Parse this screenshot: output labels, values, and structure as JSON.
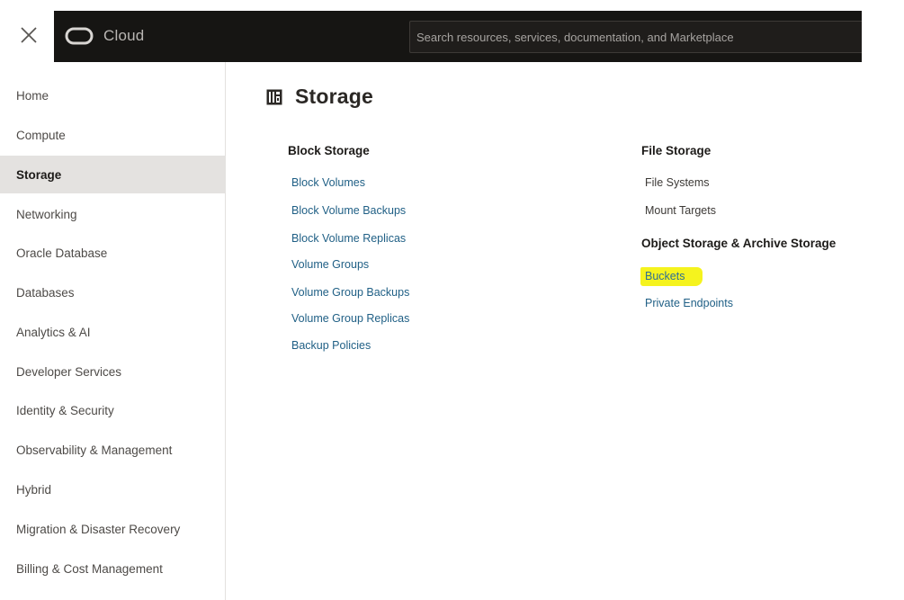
{
  "header": {
    "brand_text": "Cloud",
    "search_placeholder": "Search resources, services, documentation, and Marketplace"
  },
  "sidebar": {
    "items": [
      {
        "label": "Home",
        "active": false
      },
      {
        "label": "Compute",
        "active": false
      },
      {
        "label": "Storage",
        "active": true
      },
      {
        "label": "Networking",
        "active": false
      },
      {
        "label": "Oracle Database",
        "active": false
      },
      {
        "label": "Databases",
        "active": false
      },
      {
        "label": "Analytics & AI",
        "active": false
      },
      {
        "label": "Developer Services",
        "active": false
      },
      {
        "label": "Identity & Security",
        "active": false
      },
      {
        "label": "Observability & Management",
        "active": false
      },
      {
        "label": "Hybrid",
        "active": false
      },
      {
        "label": "Migration & Disaster Recovery",
        "active": false
      },
      {
        "label": "Billing & Cost Management",
        "active": false
      }
    ]
  },
  "main": {
    "title": "Storage",
    "block_storage": {
      "heading": "Block Storage",
      "links": [
        "Block Volumes",
        "Block Volume Backups",
        "Block Volume Replicas",
        "Volume Groups",
        "Volume Group Backups",
        "Volume Group Replicas",
        "Backup Policies"
      ]
    },
    "file_storage": {
      "heading": "File Storage",
      "links": [
        "File Systems",
        "Mount Targets"
      ]
    },
    "object_storage": {
      "heading": "Object Storage & Archive Storage",
      "links": [
        "Buckets",
        "Private Endpoints"
      ],
      "highlighted": "Buckets"
    }
  },
  "colors": {
    "topbar": "#161513",
    "link": "#1f5f85",
    "active_nav_bg": "#e4e2e0",
    "highlight": "#f5f31e"
  }
}
